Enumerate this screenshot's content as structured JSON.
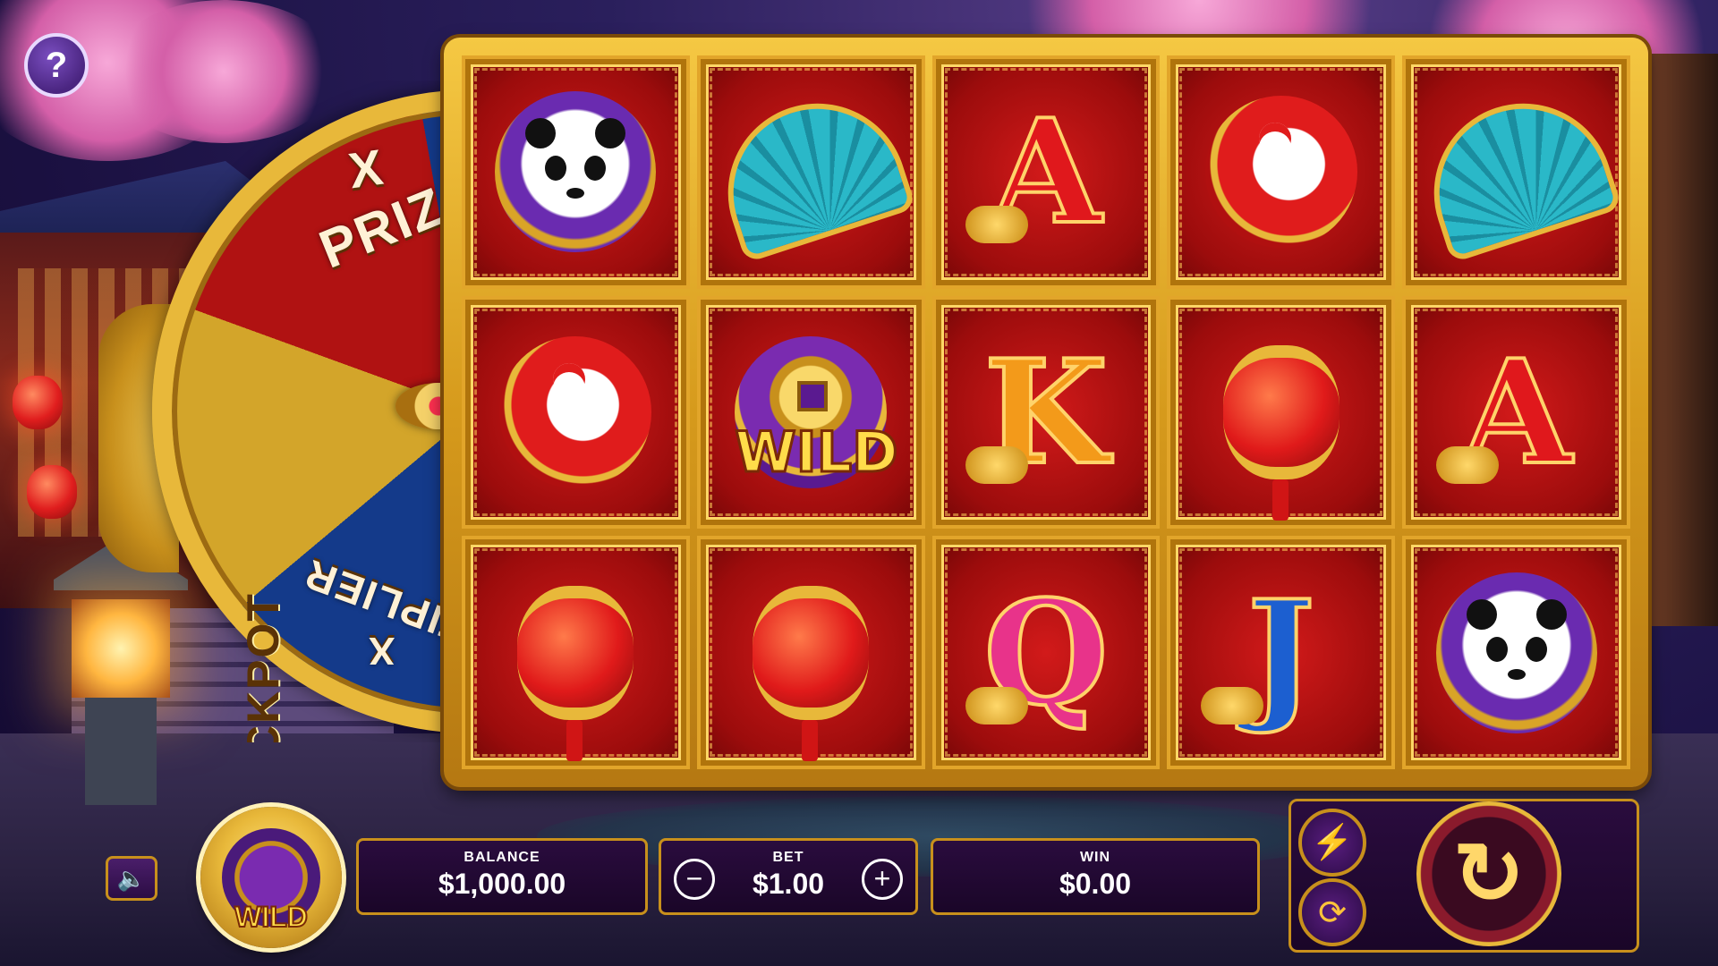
{
  "help": {
    "icon": "question-icon",
    "label": "?"
  },
  "wheel": {
    "segments": [
      "X",
      "PRIZE",
      "JACKPOT",
      "MULTIPLIER",
      "X"
    ],
    "x_top": "X",
    "prize": "PRIZ",
    "jackpot": "JACKPOT",
    "multiplier": "LTIPLIER",
    "x_bottom": "X"
  },
  "reels": {
    "rows": [
      [
        "panda",
        "fan",
        "A",
        "crane",
        "fan"
      ],
      [
        "crane",
        "WILD",
        "K",
        "lantern",
        "A"
      ],
      [
        "lantern",
        "lantern",
        "Q",
        "J",
        "panda"
      ]
    ],
    "wild_label": "WILD"
  },
  "controls": {
    "sound_icon": "speaker-icon",
    "wild_badge_label": "WILD",
    "balance_label": "BALANCE",
    "balance_value": "$1,000.00",
    "bet_label": "BET",
    "bet_value": "$1.00",
    "bet_minus": "−",
    "bet_plus": "+",
    "win_label": "WIN",
    "win_value": "$0.00",
    "turbo_icon": "lightning-icon",
    "autoplay_icon": "autoplay-icon",
    "spin_icon": "spin-icon"
  },
  "colors": {
    "gold": "#e8b83a",
    "red": "#c01010",
    "purple": "#2a0c3e"
  }
}
